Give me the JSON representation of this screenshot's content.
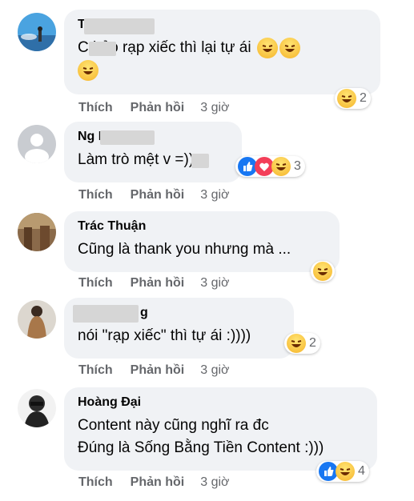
{
  "comments": [
    {
      "author": "T",
      "text_line1": "C     bảo rạp xiếc thì lại tự ái",
      "reaction_count": "2",
      "actions": {
        "like": "Thích",
        "reply": "Phản hồi",
        "time": "3 giờ"
      }
    },
    {
      "author": "Ng          Nh",
      "text": "Làm trò mệt v  =))",
      "reaction_count": "3",
      "actions": {
        "like": "Thích",
        "reply": "Phản hồi",
        "time": "3 giờ"
      }
    },
    {
      "author": "Trác Thuận",
      "text": "Cũng là thank you nhưng mà ...",
      "actions": {
        "like": "Thích",
        "reply": "Phản hồi",
        "time": "3 giờ"
      }
    },
    {
      "author": "g",
      "text": "nói \"rạp xiếc\" thì tự ái :))))",
      "reaction_count": "2",
      "actions": {
        "like": "Thích",
        "reply": "Phản hồi",
        "time": "3 giờ"
      }
    },
    {
      "author": "Hoàng Đại",
      "text_line1": "Content này cũng nghĩ ra đc",
      "text_line2": "Đúng là Sống Bằng Tiền Content :)))",
      "reaction_count": "4",
      "actions": {
        "like": "Thích",
        "reply": "Phản hồi",
        "time": "3 giờ"
      }
    }
  ],
  "icons": {
    "haha": "haha-reaction-icon",
    "like": "like-reaction-icon",
    "love": "love-reaction-icon"
  }
}
